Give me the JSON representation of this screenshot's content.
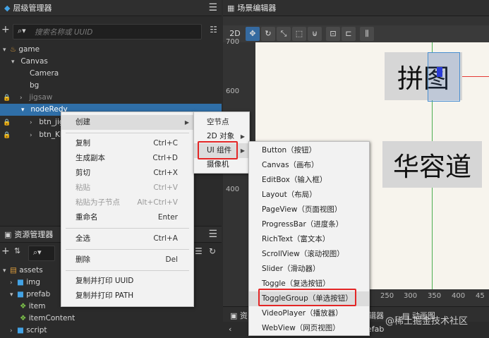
{
  "hierarchy": {
    "title": "层级管理器",
    "search_placeholder": "搜索名称或 UUID",
    "nodes": [
      {
        "label": "game"
      },
      {
        "label": "Canvas"
      },
      {
        "label": "Camera"
      },
      {
        "label": "bg"
      },
      {
        "label": "jigsaw"
      },
      {
        "label": "nodeRedy"
      },
      {
        "label": "btn_jig"
      },
      {
        "label": "btn_Kl"
      }
    ]
  },
  "scene": {
    "title": "场景编辑器",
    "mode": "2D",
    "ruler_y": [
      "700",
      "600",
      "400"
    ],
    "ruler_x": [
      "250",
      "300",
      "350",
      "400",
      "45"
    ],
    "node_jigsaw_text": "拼图",
    "node_huarong_text": "华容道"
  },
  "assets": {
    "title": "资源管理器",
    "items": [
      {
        "label": "assets"
      },
      {
        "label": "img"
      },
      {
        "label": "prefab"
      },
      {
        "label": "item"
      },
      {
        "label": "itemContent"
      },
      {
        "label": "script"
      }
    ]
  },
  "bottom_tabs": {
    "tab1": "资",
    "tab2": "辑器",
    "tab3": "动画图",
    "prefab_label": "efab"
  },
  "context_menu": {
    "items": [
      {
        "label": "创建",
        "shortcut": ""
      },
      {
        "label": "复制",
        "shortcut": "Ctrl+C"
      },
      {
        "label": "生成副本",
        "shortcut": "Ctrl+D"
      },
      {
        "label": "剪切",
        "shortcut": "Ctrl+X"
      },
      {
        "label": "粘贴",
        "shortcut": "Ctrl+V"
      },
      {
        "label": "粘贴为子节点",
        "shortcut": "Alt+Ctrl+V"
      },
      {
        "label": "重命名",
        "shortcut": "Enter"
      },
      {
        "label": "全选",
        "shortcut": "Ctrl+A"
      },
      {
        "label": "删除",
        "shortcut": "Del"
      },
      {
        "label": "复制并打印 UUID",
        "shortcut": ""
      },
      {
        "label": "复制并打印 PATH",
        "shortcut": ""
      }
    ]
  },
  "create_menu": {
    "items": [
      {
        "label": "空节点"
      },
      {
        "label": "2D 对象"
      },
      {
        "label": "UI 组件"
      },
      {
        "label": "摄像机"
      }
    ]
  },
  "ui_menu": {
    "items": [
      {
        "label": "Button（按钮）"
      },
      {
        "label": "Canvas（画布）"
      },
      {
        "label": "EditBox（输入框）"
      },
      {
        "label": "Layout（布局）"
      },
      {
        "label": "PageView（页面视图）"
      },
      {
        "label": "ProgressBar（进度条）"
      },
      {
        "label": "RichText（富文本）"
      },
      {
        "label": "ScrollView（滚动视图）"
      },
      {
        "label": "Slider（滑动器）"
      },
      {
        "label": "Toggle（复选按钮）"
      },
      {
        "label": "ToggleGroup（单选按钮）"
      },
      {
        "label": "VideoPlayer（播放器）"
      },
      {
        "label": "WebView（网页视图）"
      }
    ]
  },
  "watermark": "@稀土掘金技术社区"
}
